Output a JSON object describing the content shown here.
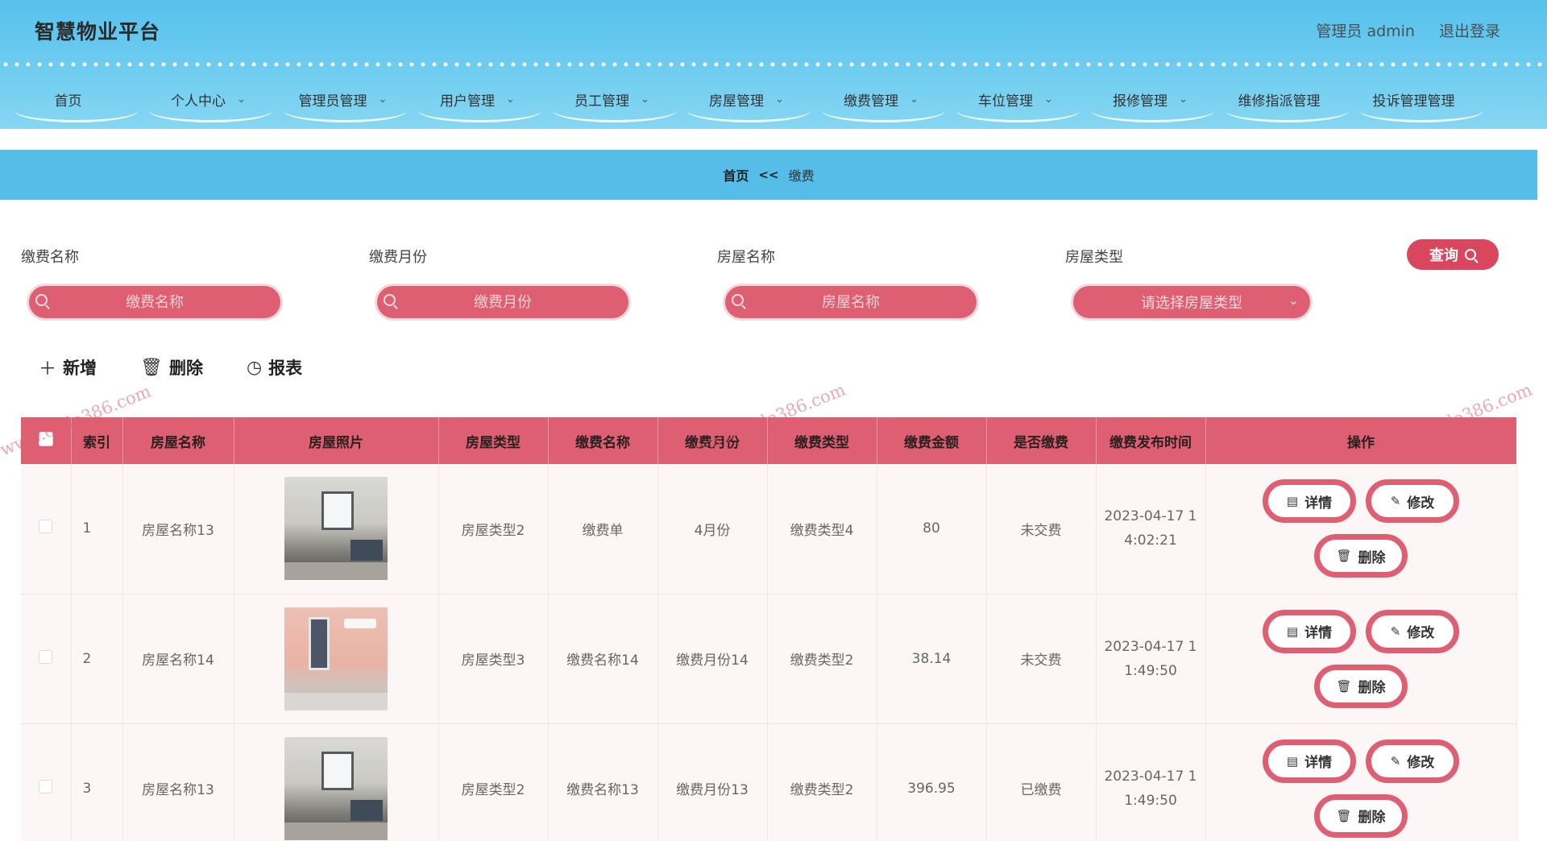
{
  "header": {
    "brand": "智慧物业平台",
    "user_label": "管理员 admin",
    "logout_label": "退出登录"
  },
  "nav": {
    "items": [
      {
        "label": "首页",
        "chevron": ""
      },
      {
        "label": "个人中心",
        "chevron": "⌄"
      },
      {
        "label": "管理员管理",
        "chevron": "⌄"
      },
      {
        "label": "用户管理",
        "chevron": "⌄"
      },
      {
        "label": "员工管理",
        "chevron": "⌄"
      },
      {
        "label": "房屋管理",
        "chevron": "⌄"
      },
      {
        "label": "缴费管理",
        "chevron": "⌄"
      },
      {
        "label": "车位管理",
        "chevron": "⌄"
      },
      {
        "label": "报修管理",
        "chevron": "⌄"
      },
      {
        "label": "维修指派管理",
        "chevron": ""
      },
      {
        "label": "投诉管理管理",
        "chevron": ""
      }
    ]
  },
  "breadcrumb": {
    "home": "首页",
    "separator": "<<",
    "current": "缴费"
  },
  "search": {
    "fields": [
      {
        "label": "缴费名称",
        "placeholder": "缴费名称"
      },
      {
        "label": "缴费月份",
        "placeholder": "缴费月份"
      },
      {
        "label": "房屋名称",
        "placeholder": "房屋名称"
      },
      {
        "label": "房屋类型",
        "placeholder": "请选择房屋类型"
      }
    ],
    "query_label": "查询"
  },
  "actions": {
    "add": {
      "label": "新增",
      "icon": "＋"
    },
    "delete": {
      "label": "删除",
      "icon": "🗑"
    },
    "report": {
      "label": "报表",
      "icon": "◷"
    }
  },
  "table": {
    "columns": [
      "",
      "索引",
      "房屋名称",
      "房屋照片",
      "房屋类型",
      "缴费名称",
      "缴费月份",
      "缴费类型",
      "缴费金额",
      "是否缴费",
      "缴费发布时间",
      "操作"
    ],
    "rows": [
      {
        "index": "1",
        "house_name": "房屋名称13",
        "photo": "room-a",
        "house_type": "房屋类型2",
        "fee_name": "缴费单",
        "fee_month": "4月份",
        "fee_type": "缴费类型4",
        "amount": "80",
        "paid": "未交费",
        "time_line1": "2023-04-17 1",
        "time_line2": "4:02:21"
      },
      {
        "index": "2",
        "house_name": "房屋名称14",
        "photo": "room-b",
        "house_type": "房屋类型3",
        "fee_name": "缴费名称14",
        "fee_month": "缴费月份14",
        "fee_type": "缴费类型2",
        "amount": "38.14",
        "paid": "未交费",
        "time_line1": "2023-04-17 1",
        "time_line2": "1:49:50"
      },
      {
        "index": "3",
        "house_name": "房屋名称13",
        "photo": "room-a",
        "house_type": "房屋类型2",
        "fee_name": "缴费名称13",
        "fee_month": "缴费月份13",
        "fee_type": "缴费类型2",
        "amount": "396.95",
        "paid": "已缴费",
        "time_line1": "2023-04-17 1",
        "time_line2": "1:49:50"
      }
    ],
    "ops": {
      "detail": "详情",
      "edit": "修改",
      "delete": "删除"
    }
  },
  "watermark": {
    "text": "www.code386.com"
  },
  "colors": {
    "header_blue": "#56c1ec",
    "accent_pink": "#de5f72"
  }
}
